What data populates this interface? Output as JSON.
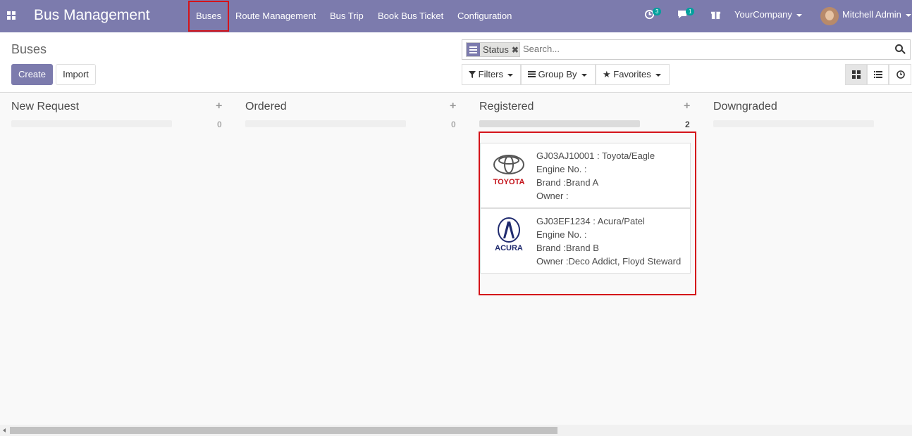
{
  "navbar": {
    "brand": "Bus Management",
    "menu": [
      "Buses",
      "Route Management",
      "Bus Trip",
      "Book Bus Ticket",
      "Configuration"
    ],
    "activity_count": "3",
    "messages_count": "1",
    "company": "YourCompany",
    "user": "Mitchell Admin"
  },
  "control": {
    "breadcrumb": "Buses",
    "create_label": "Create",
    "import_label": "Import",
    "facet_label": "Status",
    "search_placeholder": "Search...",
    "filters_label": "Filters",
    "groupby_label": "Group By",
    "favorites_label": "Favorites"
  },
  "columns": [
    {
      "title": "New Request",
      "count": "0"
    },
    {
      "title": "Ordered",
      "count": "0"
    },
    {
      "title": "Registered",
      "count": "2"
    },
    {
      "title": "Downgraded",
      "count": ""
    }
  ],
  "cards": [
    {
      "logo_text": "TOYOTA",
      "logo_color": "#c4121a",
      "title": "GJ03AJ10001 : Toyota/Eagle",
      "engine": "Engine No. :",
      "brand": "Brand :Brand A",
      "owner": "Owner :"
    },
    {
      "logo_text": "ACURA",
      "logo_color": "#1f2a6e",
      "title": "GJ03EF1234 : Acura/Patel",
      "engine": "Engine No. :",
      "brand": "Brand :Brand B",
      "owner": "Owner :Deco Addict, Floyd Steward"
    }
  ],
  "colors": {
    "navbar": "#7c7bad",
    "highlight": "#d4141a",
    "badge": "#00a09d"
  }
}
